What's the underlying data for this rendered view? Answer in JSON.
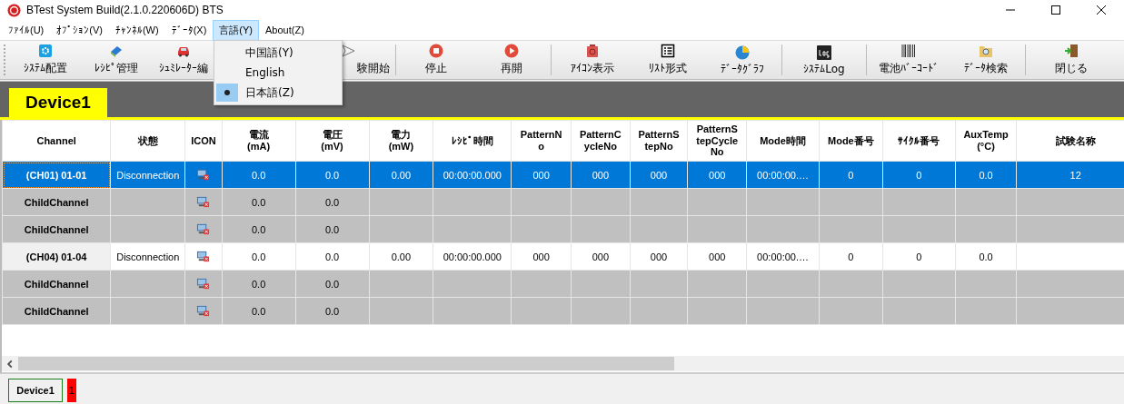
{
  "window": {
    "title": "BTest System  Build(2.1.0.220606D) BTS"
  },
  "menu": [
    {
      "label": "ﾌｧｲﾙ(U)",
      "open": false
    },
    {
      "label": "ｵﾌﾟｼｮﾝ(V)",
      "open": false
    },
    {
      "label": "ﾁｬﾝﾈﾙ(W)",
      "open": false
    },
    {
      "label": "ﾃﾞｰﾀ(X)",
      "open": false
    },
    {
      "label": "言語(Y)",
      "open": true
    },
    {
      "label": "About(Z)",
      "open": false
    }
  ],
  "language_menu": [
    {
      "label": "中国語(Y)",
      "selected": false
    },
    {
      "label": "English",
      "selected": false
    },
    {
      "label": "日本語(Z)",
      "selected": true
    }
  ],
  "toolbar": [
    {
      "label": "ｼｽﾃﾑ配置",
      "kind": "gear"
    },
    {
      "label": "ﾚｼﾋﾟ管理",
      "kind": "book"
    },
    {
      "label": "ｼｭﾐﾚｰﾀｰ編",
      "kind": "car"
    },
    {
      "label": "験開始",
      "kind": "send"
    },
    {
      "label": "停止",
      "kind": "stop"
    },
    {
      "label": "再開",
      "kind": "play"
    },
    {
      "label": "ｱｲｺﾝ表示",
      "kind": "device"
    },
    {
      "label": "ﾘｽﾄ形式",
      "kind": "grid"
    },
    {
      "label": "ﾃﾞｰﾀｸﾞﾗﾌ",
      "kind": "pie"
    },
    {
      "label": "ｼｽﾃﾑLog",
      "kind": "log"
    },
    {
      "label": "電池ﾊﾞｰｺｰﾄﾞ",
      "kind": "barcode"
    },
    {
      "label": "ﾃﾞｰﾀ検索",
      "kind": "folder"
    },
    {
      "label": "閉じる",
      "kind": "exit"
    }
  ],
  "device_tab": {
    "label": "Device1"
  },
  "table": {
    "columns": [
      "Channel",
      "状態",
      "ICON",
      "電流\n(mA)",
      "電圧\n(mV)",
      "電力\n(mW)",
      "ﾚｼﾋﾟ時間",
      "PatternN\no",
      "PatternC\nycleNo",
      "PatternS\ntepNo",
      "PatternS\ntepCycle\nNo",
      "Mode時間",
      "Mode番号",
      "ｻｲｸﾙ番号",
      "AuxTemp\n(°C)",
      "試験名称"
    ],
    "rows": [
      {
        "kind": "parent",
        "selected": true,
        "cells": [
          "(CH01) 01-01",
          "Disconnection",
          null,
          "0.0",
          "0.0",
          "0.00",
          "00:00:00.000",
          "000",
          "000",
          "000",
          "000",
          "00:00:00.…",
          "0",
          "0",
          "0.0",
          "12"
        ]
      },
      {
        "kind": "child",
        "selected": false,
        "cells": [
          "ChildChannel",
          null,
          null,
          "0.0",
          "0.0",
          null,
          null,
          null,
          null,
          null,
          null,
          null,
          null,
          null,
          null,
          null
        ]
      },
      {
        "kind": "child",
        "selected": false,
        "cells": [
          "ChildChannel",
          null,
          null,
          "0.0",
          "0.0",
          null,
          null,
          null,
          null,
          null,
          null,
          null,
          null,
          null,
          null,
          null
        ]
      },
      {
        "kind": "parent",
        "selected": false,
        "cells": [
          "(CH04) 01-04",
          "Disconnection",
          null,
          "0.0",
          "0.0",
          "0.00",
          "00:00:00.000",
          "000",
          "000",
          "000",
          "000",
          "00:00:00.…",
          "0",
          "0",
          "0.0",
          null
        ]
      },
      {
        "kind": "child",
        "selected": false,
        "cells": [
          "ChildChannel",
          null,
          null,
          "0.0",
          "0.0",
          null,
          null,
          null,
          null,
          null,
          null,
          null,
          null,
          null,
          null,
          null
        ]
      },
      {
        "kind": "child",
        "selected": false,
        "cells": [
          "ChildChannel",
          null,
          null,
          "0.0",
          "0.0",
          null,
          null,
          null,
          null,
          null,
          null,
          null,
          null,
          null,
          null,
          null
        ]
      }
    ]
  },
  "status_bar": {
    "device": "Device1",
    "count": "1"
  }
}
